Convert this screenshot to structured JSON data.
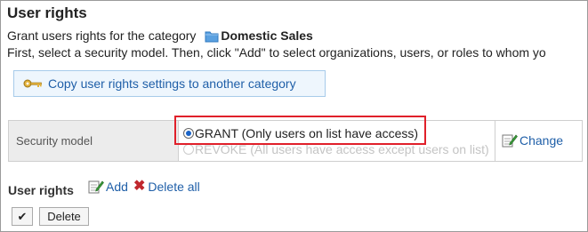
{
  "title": "User rights",
  "description": {
    "line1_prefix": "Grant users rights for the category",
    "category": "Domestic Sales",
    "line2": "First, select a security model. Then, click \"Add\" to select organizations, users, or roles to whom yo"
  },
  "copy_button": {
    "label": "Copy user rights settings to another category",
    "icon": "key-icon"
  },
  "security": {
    "header": "Security model",
    "options": [
      {
        "label": "GRANT (Only users on list have access)",
        "selected": true
      },
      {
        "label": "REVOKE (All users have access except users on list)",
        "selected": false
      }
    ],
    "change_label": "Change"
  },
  "user_rights": {
    "label": "User rights",
    "add_label": "Add",
    "delete_all_label": "Delete all",
    "check_label": "✔",
    "delete_label": "Delete"
  },
  "colors": {
    "link": "#1f5fa8",
    "highlight": "#e0202a",
    "header_bg": "#ececec"
  }
}
